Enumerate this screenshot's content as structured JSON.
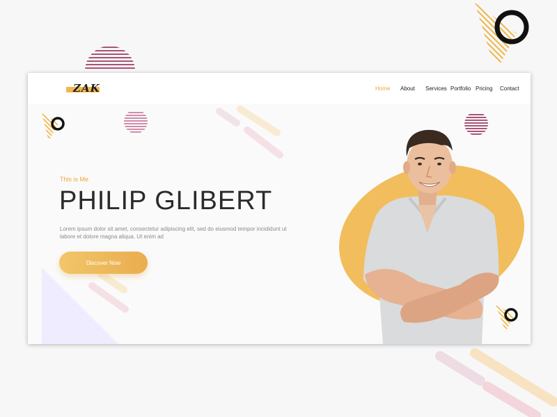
{
  "header": {
    "logo_text": "ZAK",
    "nav": [
      {
        "label": "Home",
        "active": true
      },
      {
        "label": "About",
        "active": false
      },
      {
        "label": "Services",
        "active": false
      },
      {
        "label": "Portfolio",
        "active": false
      },
      {
        "label": "Pricing",
        "active": false
      },
      {
        "label": "Contact",
        "active": false
      }
    ]
  },
  "hero": {
    "tagline": "This is Me",
    "name": "PHILIP GLIBERT",
    "description": "Lorem ipsum dolor sit amet, consectetur adipiscing elit, sed do eiusmod tempor incididunt ut labore et dolore magna aliqua. Ut enim ad",
    "cta_label": "Discover Now",
    "portrait": "man-arms-crossed-photo"
  },
  "colors": {
    "accent": "#f0a53a",
    "button_gradient_start": "#f2c66a",
    "button_gradient_end": "#e9ad4f",
    "blob": "#f2bd5c",
    "stripe_circle": "#8e1c4b",
    "page_background": "#f7f7f7",
    "heading": "#2b2b2b"
  },
  "icons": [
    "triangle-stripes-icon",
    "ring-icon",
    "striped-semicircle-icon",
    "striped-circle-icon",
    "pill-stripes-icon"
  ]
}
